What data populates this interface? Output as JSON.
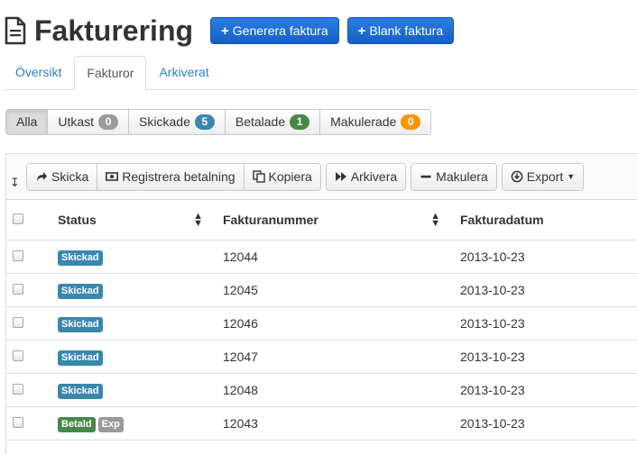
{
  "header": {
    "title": "Fakturering",
    "buttons": [
      {
        "label": "Generera faktura"
      },
      {
        "label": "Blank faktura"
      }
    ]
  },
  "tabs": [
    {
      "label": "Översikt",
      "active": false
    },
    {
      "label": "Fakturor",
      "active": true
    },
    {
      "label": "Arkiverat",
      "active": false
    }
  ],
  "filters": [
    {
      "label": "Alla",
      "active": true
    },
    {
      "label": "Utkast",
      "count": "0",
      "color": "#9a9a9a"
    },
    {
      "label": "Skickade",
      "count": "5",
      "color": "#3a87ad"
    },
    {
      "label": "Betalade",
      "count": "1",
      "color": "#468847"
    },
    {
      "label": "Makulerade",
      "count": "0",
      "color": "#f89406"
    }
  ],
  "toolbar": {
    "send": "Skicka",
    "register_payment": "Registrera betalning",
    "copy": "Kopiera",
    "archive": "Arkivera",
    "void": "Makulera",
    "export": "Export"
  },
  "table": {
    "columns": [
      "Status",
      "Fakturanummer",
      "Fakturadatum"
    ],
    "rows": [
      {
        "status": "Skickad",
        "status_color": "#3a87ad",
        "extra": "",
        "number": "12044",
        "date": "2013-10-23"
      },
      {
        "status": "Skickad",
        "status_color": "#3a87ad",
        "extra": "",
        "number": "12045",
        "date": "2013-10-23"
      },
      {
        "status": "Skickad",
        "status_color": "#3a87ad",
        "extra": "",
        "number": "12046",
        "date": "2013-10-23"
      },
      {
        "status": "Skickad",
        "status_color": "#3a87ad",
        "extra": "",
        "number": "12047",
        "date": "2013-10-23"
      },
      {
        "status": "Skickad",
        "status_color": "#3a87ad",
        "extra": "",
        "number": "12048",
        "date": "2013-10-23"
      },
      {
        "status": "Betald",
        "status_color": "#468847",
        "extra": "Exp",
        "number": "12043",
        "date": "2013-10-23"
      }
    ]
  }
}
